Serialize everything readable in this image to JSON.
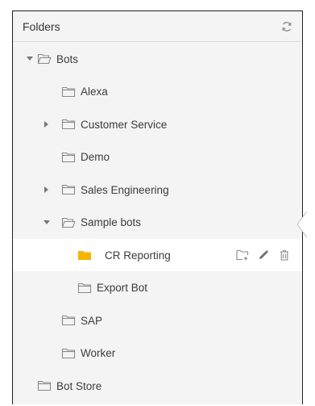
{
  "panel": {
    "title": "Folders",
    "refresh_icon": "refresh-icon"
  },
  "tree": [
    {
      "label": "Bots",
      "level": 0,
      "expanded": true,
      "has_children": true,
      "open_folder": true
    },
    {
      "label": "Alexa",
      "level": 1,
      "has_children": false
    },
    {
      "label": "Customer Service",
      "level": 1,
      "has_children": true,
      "expanded": false
    },
    {
      "label": "Demo",
      "level": 1,
      "has_children": false
    },
    {
      "label": "Sales Engineering",
      "level": 1,
      "has_children": true,
      "expanded": false
    },
    {
      "label": "Sample bots",
      "level": 1,
      "has_children": true,
      "expanded": true,
      "open_folder": true
    },
    {
      "label": "CR Reporting",
      "level": 2,
      "has_children": false,
      "selected": true
    },
    {
      "label": "Export Bot",
      "level": 2,
      "has_children": false
    },
    {
      "label": "SAP",
      "level": 1,
      "has_children": false
    },
    {
      "label": "Worker",
      "level": 1,
      "has_children": false
    },
    {
      "label": "Bot Store",
      "level": 0,
      "has_children": false
    }
  ],
  "selected_actions": [
    "new-folder-icon",
    "edit-icon",
    "delete-icon"
  ],
  "colors": {
    "selected_folder": "#f5b400",
    "icon_gray": "#8a8a8a",
    "panel_bg": "#f4f4f4"
  }
}
